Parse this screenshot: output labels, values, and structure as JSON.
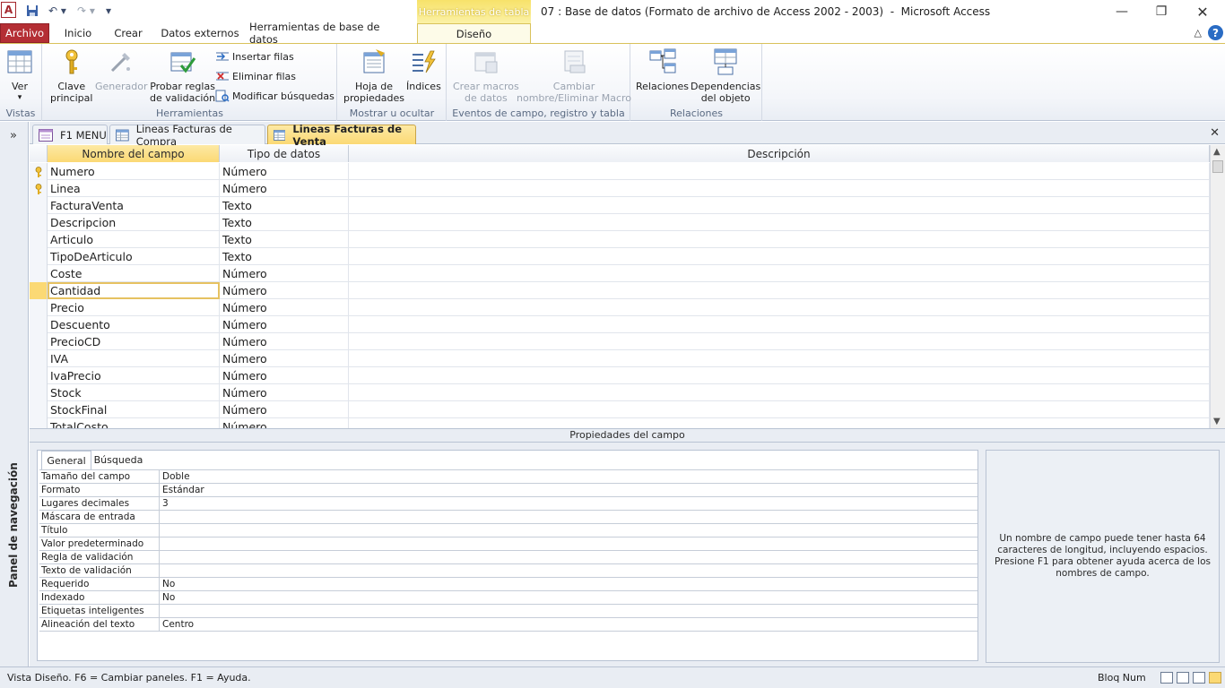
{
  "window": {
    "title": "07 : Base de datos (Formato de archivo de Access 2002 - 2003)  -  Microsoft Access",
    "context_tab_header": "Herramientas de tabla",
    "logo_letter": "A"
  },
  "ribbon_tabs": [
    "Archivo",
    "Inicio",
    "Crear",
    "Datos externos",
    "Herramientas de base de datos",
    "Diseño"
  ],
  "ribbon": {
    "vistas": {
      "label": "Vistas",
      "ver": "Ver"
    },
    "herramientas": {
      "label": "Herramientas",
      "clave_principal": [
        "Clave",
        "principal"
      ],
      "generador": "Generador",
      "probar_reglas": [
        "Probar reglas",
        "de validación"
      ],
      "insertar_filas": "Insertar filas",
      "eliminar_filas": "Eliminar filas",
      "modificar_busquedas": "Modificar búsquedas"
    },
    "mostrar": {
      "label": "Mostrar u ocultar",
      "hoja_propiedades": [
        "Hoja de",
        "propiedades"
      ],
      "indices": "Índices"
    },
    "eventos": {
      "label": "Eventos de campo, registro y tabla",
      "crear_macros": [
        "Crear macros",
        "de datos"
      ],
      "cambiar_nombre": [
        "Cambiar",
        "nombre/Eliminar Macro"
      ]
    },
    "relaciones": {
      "label": "Relaciones",
      "relaciones_btn": "Relaciones",
      "dependencias": [
        "Dependencias",
        "del objeto"
      ]
    }
  },
  "navigation_pane": {
    "label": "Panel de navegación",
    "expand": "»"
  },
  "document_tabs": [
    {
      "label": "F1 MENU",
      "active": false
    },
    {
      "label": "Lineas Facturas de Compra",
      "active": false
    },
    {
      "label": "Lineas Facturas de Venta",
      "active": true
    }
  ],
  "grid": {
    "headers": [
      "Nombre del campo",
      "Tipo de datos",
      "Descripción"
    ],
    "rows": [
      {
        "name": "Numero",
        "type": "Número",
        "key": true
      },
      {
        "name": "Linea",
        "type": "Número",
        "key": true
      },
      {
        "name": "FacturaVenta",
        "type": "Texto",
        "key": false
      },
      {
        "name": "Descripcion",
        "type": "Texto",
        "key": false
      },
      {
        "name": "Articulo",
        "type": "Texto",
        "key": false
      },
      {
        "name": "TipoDeArticulo",
        "type": "Texto",
        "key": false
      },
      {
        "name": "Coste",
        "type": "Número",
        "key": false
      },
      {
        "name": "Cantidad",
        "type": "Número",
        "key": false,
        "current": true
      },
      {
        "name": "Precio",
        "type": "Número",
        "key": false
      },
      {
        "name": "Descuento",
        "type": "Número",
        "key": false
      },
      {
        "name": "PrecioCD",
        "type": "Número",
        "key": false
      },
      {
        "name": "IVA",
        "type": "Número",
        "key": false
      },
      {
        "name": "IvaPrecio",
        "type": "Número",
        "key": false
      },
      {
        "name": "Stock",
        "type": "Número",
        "key": false
      },
      {
        "name": "StockFinal",
        "type": "Número",
        "key": false
      },
      {
        "name": "TotalCosto",
        "type": "Número",
        "key": false
      }
    ]
  },
  "field_properties": {
    "title": "Propiedades del campo",
    "tabs": [
      "General",
      "Búsqueda"
    ],
    "rows": [
      {
        "name": "Tamaño del campo",
        "value": "Doble"
      },
      {
        "name": "Formato",
        "value": "Estándar"
      },
      {
        "name": "Lugares decimales",
        "value": "3"
      },
      {
        "name": "Máscara de entrada",
        "value": ""
      },
      {
        "name": "Título",
        "value": ""
      },
      {
        "name": "Valor predeterminado",
        "value": ""
      },
      {
        "name": "Regla de validación",
        "value": ""
      },
      {
        "name": "Texto de validación",
        "value": ""
      },
      {
        "name": "Requerido",
        "value": "No"
      },
      {
        "name": "Indexado",
        "value": "No"
      },
      {
        "name": "Etiquetas inteligentes",
        "value": ""
      },
      {
        "name": "Alineación del texto",
        "value": "Centro"
      }
    ],
    "help_text": "Un nombre de campo puede tener hasta 64 caracteres de longitud, incluyendo espacios. Presione F1 para obtener ayuda acerca de los nombres de campo."
  },
  "status_bar": {
    "left": "Vista Diseño.  F6 = Cambiar paneles.  F1 = Ayuda.",
    "bloq_num": "Bloq Num"
  },
  "colors": {
    "archivo": "#b42e34",
    "context": "#f7e26a",
    "selection": "#fbd974",
    "accent_blue": "#2a6cc4"
  }
}
